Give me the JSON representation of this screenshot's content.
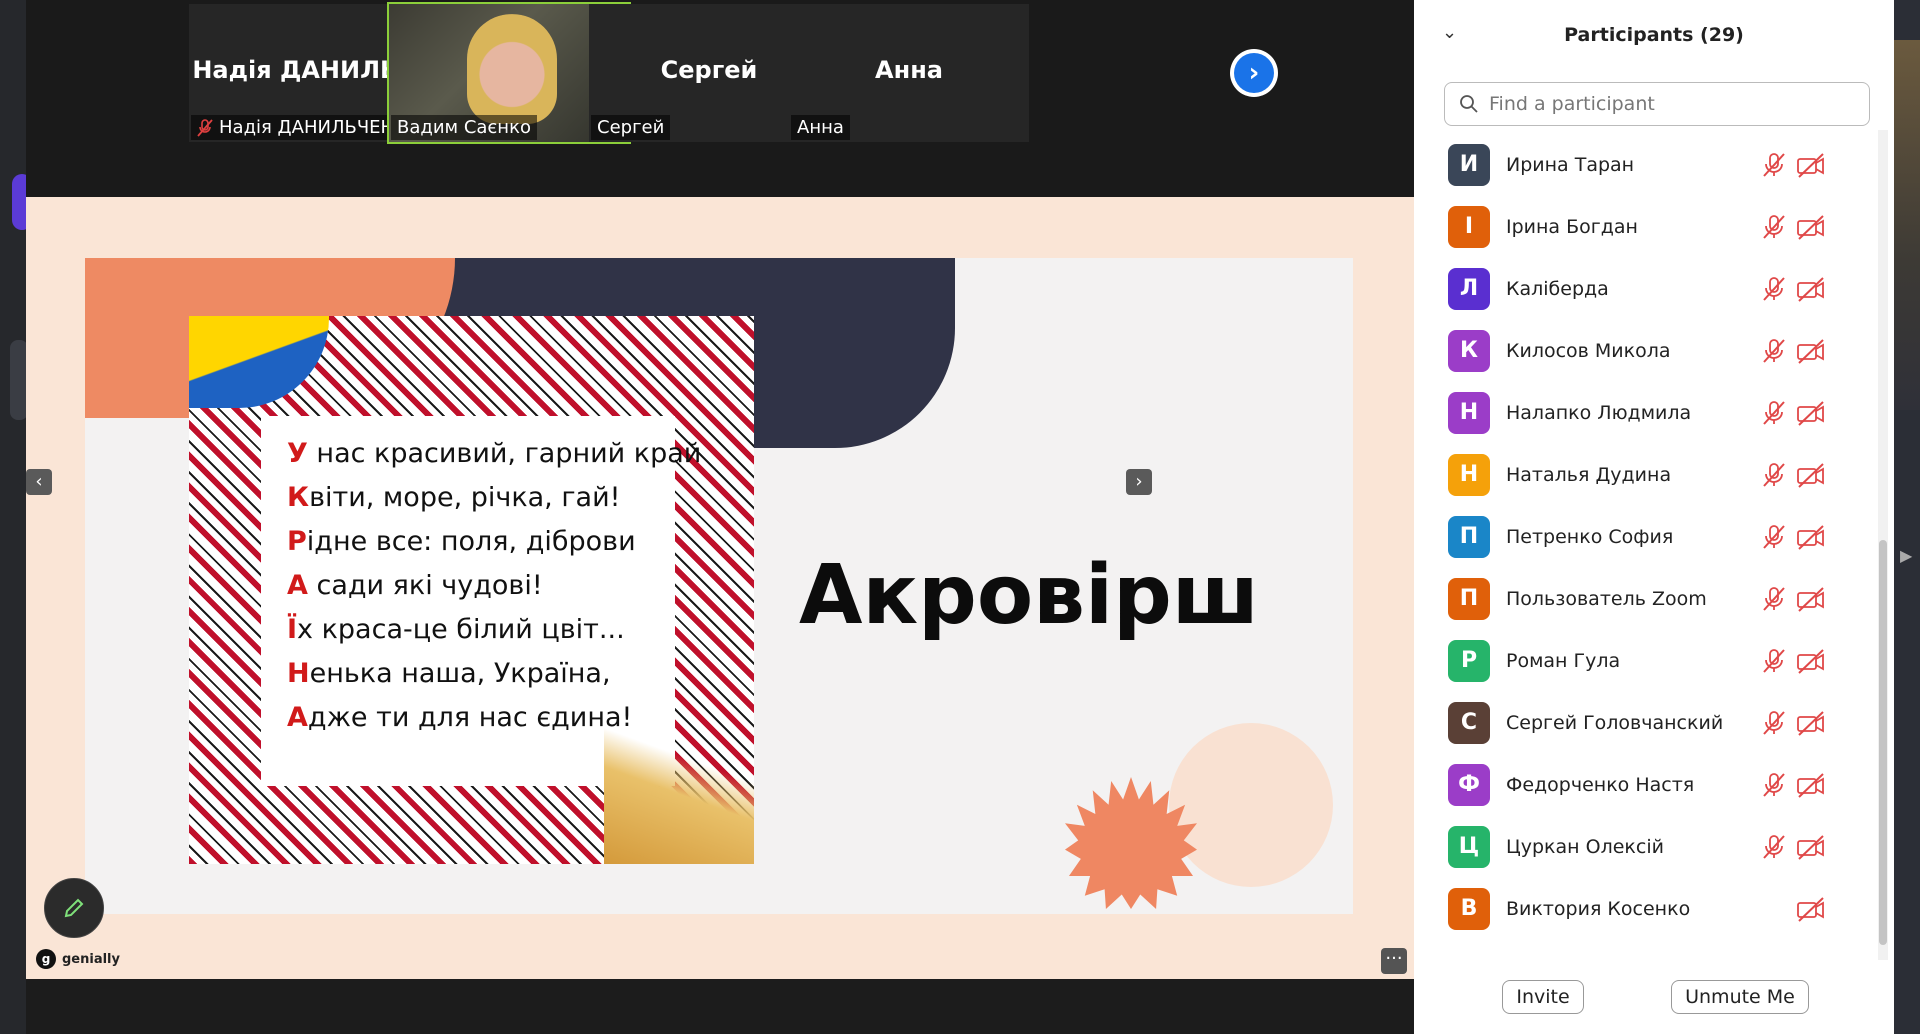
{
  "video_strip": {
    "tiles": [
      {
        "display_name": "Надія ДАНИЛЬ...",
        "label": "Надія ДАНИЛЬЧЕНКО",
        "muted": true,
        "video": false
      },
      {
        "display_name": "",
        "label": "Вадим Саєнко",
        "muted": false,
        "video": true
      },
      {
        "display_name": "Сергей",
        "label": "Сергей",
        "muted": false,
        "video": false
      },
      {
        "display_name": "Анна",
        "label": "Анна",
        "muted": false,
        "video": false
      }
    ]
  },
  "slide": {
    "title": "Акровірш",
    "poem": [
      {
        "first": "У",
        "rest": " нас красивий, гарний край"
      },
      {
        "first": "К",
        "rest": "віти, море, річка, гай!"
      },
      {
        "first": "Р",
        "rest": "ідне все: поля, діброви"
      },
      {
        "first": "А",
        "rest": " сади які чудові!"
      },
      {
        "first": "Ї",
        "rest": "х краса-це білий цвіт..."
      },
      {
        "first": "Н",
        "rest": "енька наша, Україна,"
      },
      {
        "first": "А",
        "rest": "дже ти для нас єдина!"
      }
    ],
    "nav_prev": "‹",
    "nav_next": "›",
    "brand": "genially",
    "more": "···"
  },
  "participants": {
    "title": "Participants (29)",
    "search_placeholder": "Find a participant",
    "list": [
      {
        "initial": "И",
        "name": "Ирина Таран",
        "color": "#3a4658",
        "mic_muted": true
      },
      {
        "initial": "І",
        "name": "Ірина Богдан",
        "color": "#e0600a",
        "mic_muted": true
      },
      {
        "initial": "Л",
        "name": "Каліберда",
        "color": "#5a2fd0",
        "mic_muted": true
      },
      {
        "initial": "К",
        "name": "Килосов Микола",
        "color": "#9b3dc8",
        "mic_muted": true
      },
      {
        "initial": "Н",
        "name": "Налапко Людмила",
        "color": "#9b3dc8",
        "mic_muted": true
      },
      {
        "initial": "Н",
        "name": "Наталья Дудина",
        "color": "#f5a10a",
        "mic_muted": true
      },
      {
        "initial": "П",
        "name": "Петренко София",
        "color": "#1a86c8",
        "mic_muted": true
      },
      {
        "initial": "П",
        "name": "Пользователь Zoom",
        "color": "#e0600a",
        "mic_muted": true
      },
      {
        "initial": "Р",
        "name": "Роман Гула",
        "color": "#26b46a",
        "mic_muted": true
      },
      {
        "initial": "С",
        "name": "Сергей Головчанский",
        "color": "#5a4036",
        "mic_muted": true
      },
      {
        "initial": "Ф",
        "name": "Федорченко Настя",
        "color": "#9b3dc8",
        "mic_muted": true
      },
      {
        "initial": "Ц",
        "name": "Цуркан Олексій",
        "color": "#26b46a",
        "mic_muted": true
      },
      {
        "initial": "В",
        "name": "Виктория Косенко",
        "color": "#e0600a",
        "mic_muted": false
      }
    ],
    "invite_label": "Invite",
    "unmute_label": "Unmute Me"
  }
}
